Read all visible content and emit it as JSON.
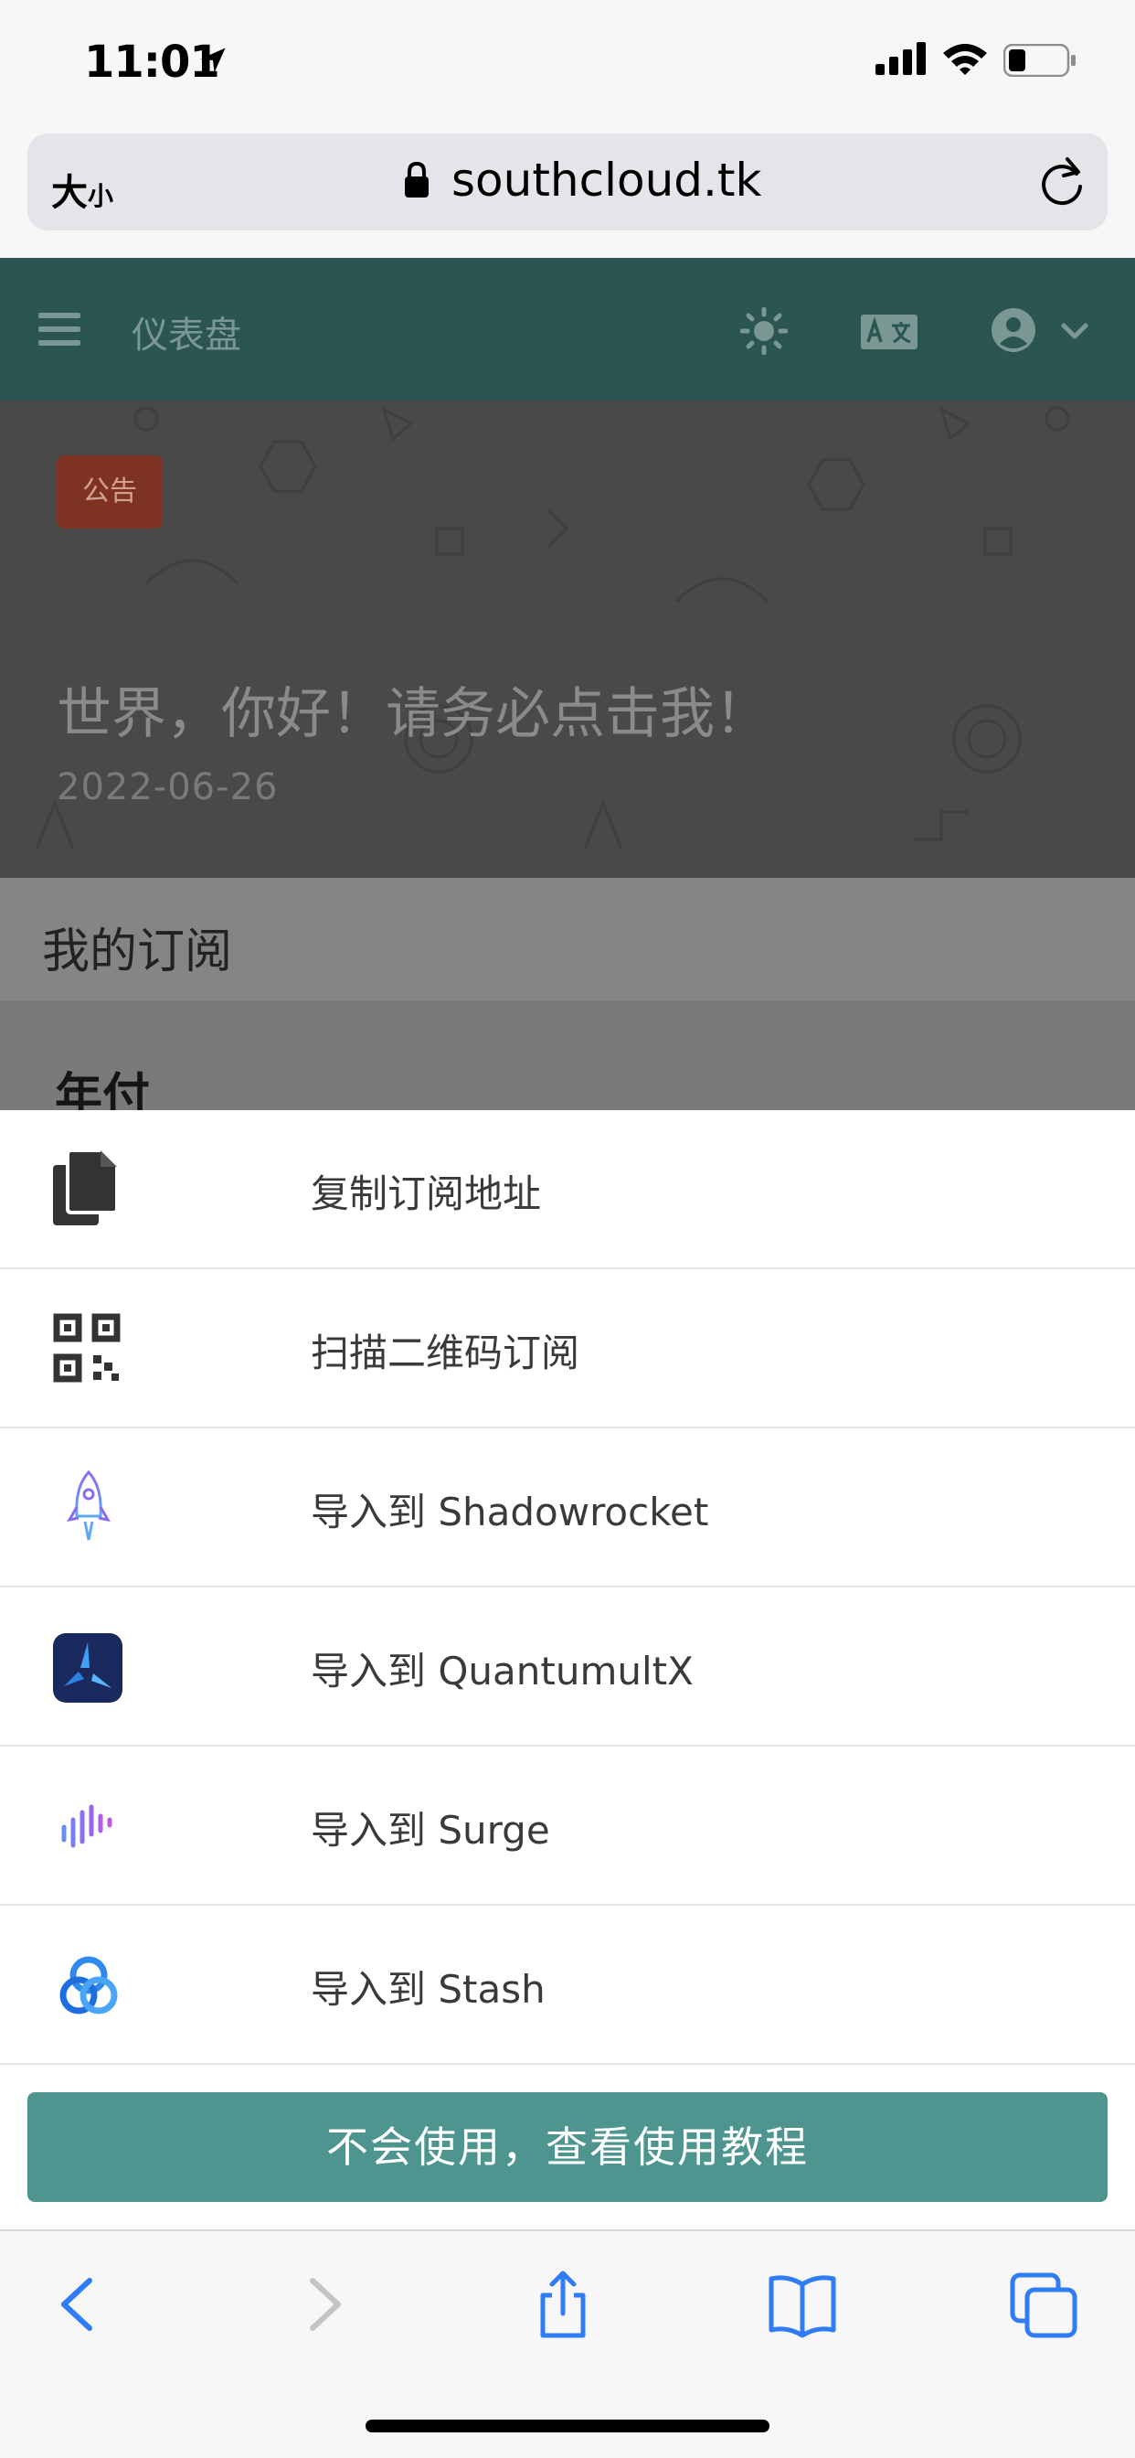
{
  "status_bar": {
    "time": "11:01"
  },
  "browser": {
    "text_size_label": "大",
    "text_size_label_small": "小",
    "url": "southcloud.tk"
  },
  "nav": {
    "title": "仪表盘"
  },
  "notice": {
    "badge": "公告",
    "title": "世界，你好！请务必点击我！",
    "date": "2022-06-26"
  },
  "subscription": {
    "section_title": "我的订阅",
    "plan_name": "年付"
  },
  "action_sheet": {
    "items": [
      {
        "label": "复制订阅地址",
        "icon": "copy-icon"
      },
      {
        "label": "扫描二维码订阅",
        "icon": "qrcode-icon"
      },
      {
        "label": "导入到 Shadowrocket",
        "icon": "shadowrocket-icon"
      },
      {
        "label": "导入到 QuantumultX",
        "icon": "quantumultx-icon"
      },
      {
        "label": "导入到 Surge",
        "icon": "surge-icon"
      },
      {
        "label": "导入到 Stash",
        "icon": "stash-icon"
      }
    ],
    "tutorial_button": "不会使用，查看使用教程"
  },
  "colors": {
    "nav_bg": "#2a5551",
    "badge_bg": "#7e3322",
    "button_bg": "#4e9590",
    "ios_blue": "#2f7cf6"
  }
}
